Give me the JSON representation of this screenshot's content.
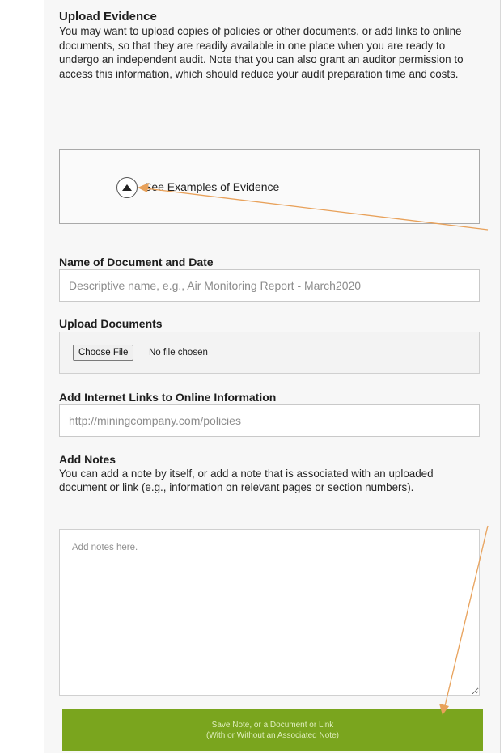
{
  "upload_evidence": {
    "title": "Upload Evidence",
    "description": "You may want to upload copies of policies or other documents, or add links to online documents, so that they are readily available in one place when you are ready to undergo an independent audit. Note that you can also grant an auditor permission to access this information, which should reduce your audit preparation time and costs."
  },
  "examples": {
    "label": "See Examples of Evidence"
  },
  "document_name": {
    "label": "Name of Document and Date",
    "placeholder": "Descriptive name, e.g., Air Monitoring Report - March2020"
  },
  "upload": {
    "label": "Upload Documents",
    "button_label": "Choose File",
    "status": "No file chosen"
  },
  "links": {
    "label": "Add Internet Links to Online Information",
    "placeholder": "http://miningcompany.com/policies"
  },
  "notes": {
    "label": "Add Notes",
    "description": "You can add a note by itself, or add a note that is associated with an uploaded document or link (e.g., information on relevant pages or section numbers).",
    "placeholder": "Add notes here."
  },
  "save_button": {
    "line1": "Save Note, or a Document or Link",
    "line2": "(With or Without an Associated Note)"
  },
  "colors": {
    "save_button_bg": "#7aa51e",
    "annotation_arrow": "#e8a15a"
  }
}
